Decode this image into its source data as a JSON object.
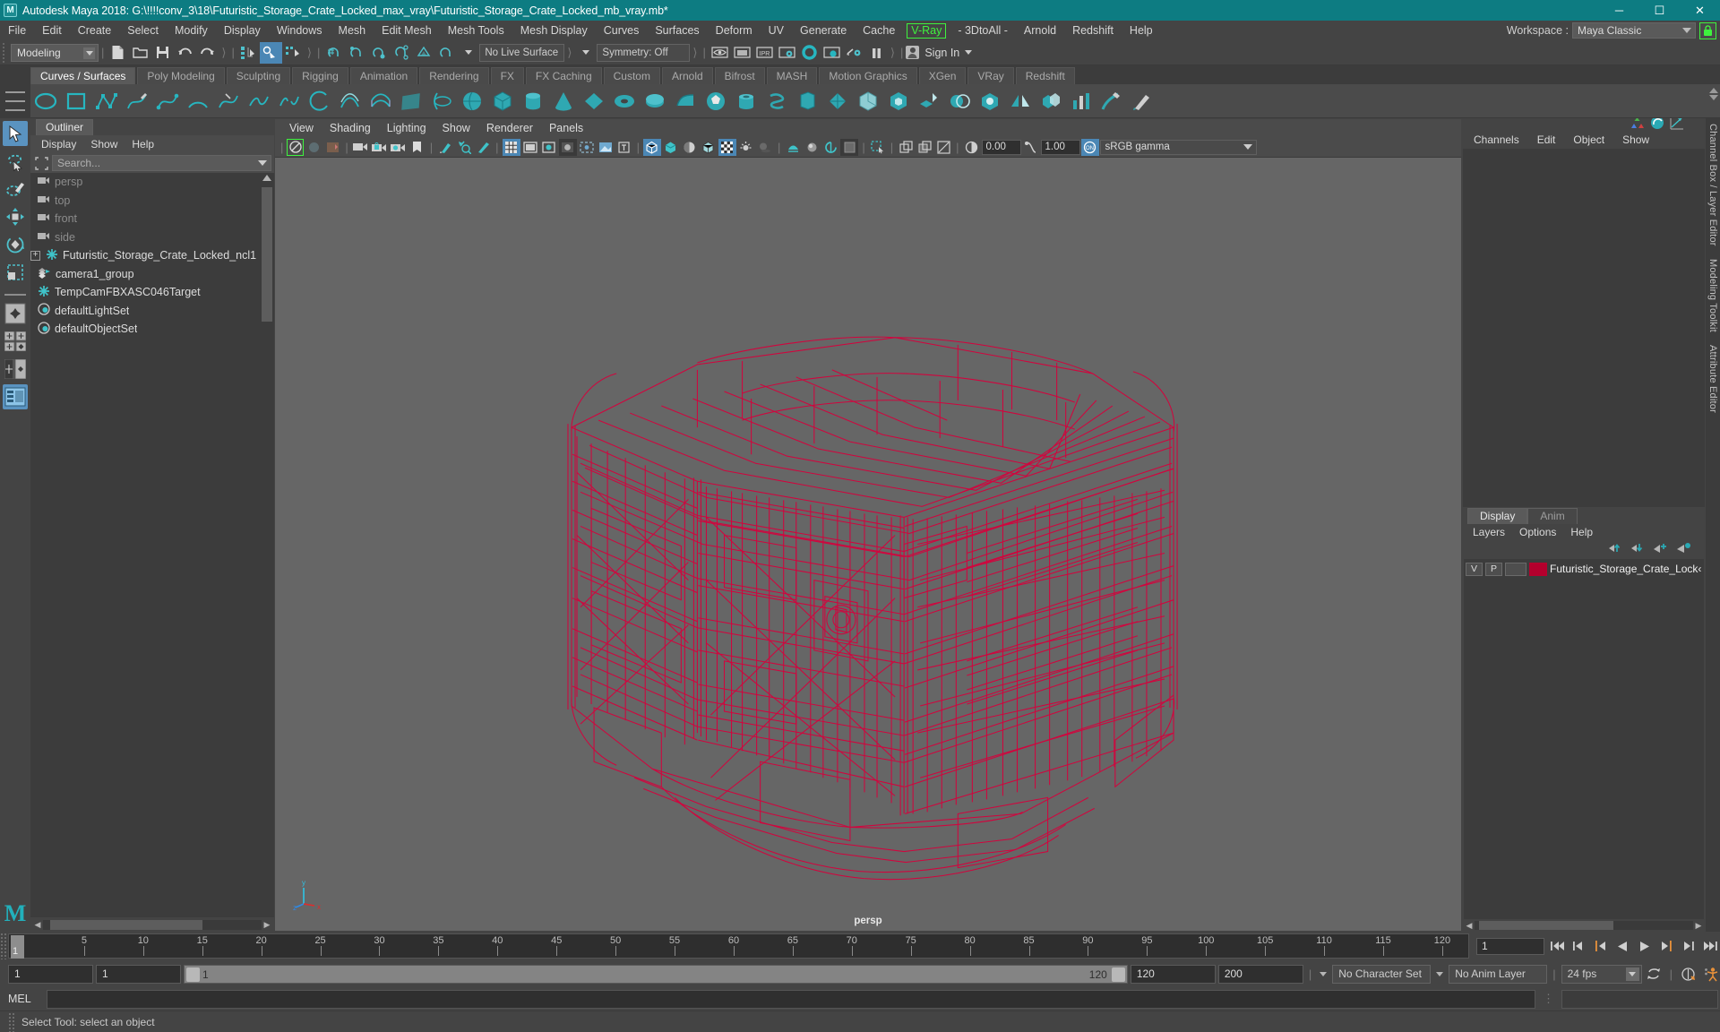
{
  "titlebar": {
    "app_title": "Autodesk Maya 2018: G:\\!!!!conv_3\\18\\Futuristic_Storage_Crate_Locked_max_vray\\Futuristic_Storage_Crate_Locked_mb_vray.mb*",
    "logo": "M",
    "minimize": "─",
    "maximize": "☐",
    "close": "✕"
  },
  "menubar": {
    "items": [
      "File",
      "Edit",
      "Create",
      "Select",
      "Modify",
      "Display",
      "Windows",
      "Mesh",
      "Edit Mesh",
      "Mesh Tools",
      "Mesh Display",
      "Curves",
      "Surfaces",
      "Deform",
      "UV",
      "Generate",
      "Cache"
    ],
    "vray": "V-Ray",
    "after_vray": [
      "- 3DtoAll -",
      "Arnold",
      "Redshift",
      "Help"
    ],
    "workspace_label": "Workspace :",
    "workspace_value": "Maya Classic",
    "lock_icon": "lock-icon"
  },
  "statusline": {
    "mode": "Modeling",
    "no_live_surface": "No Live Surface",
    "symmetry": "Symmetry: Off",
    "sign_in": "Sign In"
  },
  "shelf": {
    "tabs": [
      "Curves / Surfaces",
      "Poly Modeling",
      "Sculpting",
      "Rigging",
      "Animation",
      "Rendering",
      "FX",
      "FX Caching",
      "Custom",
      "Arnold",
      "Bifrost",
      "MASH",
      "Motion Graphics",
      "XGen",
      "VRay",
      "Redshift"
    ],
    "active_tab": "Curves / Surfaces"
  },
  "toolbox": {
    "items": [
      "select-tool",
      "lasso-select-tool",
      "paint-select-tool",
      "move-tool",
      "rotate-tool",
      "scale-tool",
      "last-tool",
      "snap-grid",
      "layout-four-view",
      "layout-two-pane",
      "layout-outliner"
    ]
  },
  "outliner": {
    "tab": "Outliner",
    "menus": [
      "Display",
      "Show",
      "Help"
    ],
    "search_placeholder": "Search...",
    "items": [
      {
        "label": "persp",
        "icon": "camera-icon",
        "dim": true,
        "expandable": false
      },
      {
        "label": "top",
        "icon": "camera-icon",
        "dim": true,
        "expandable": false
      },
      {
        "label": "front",
        "icon": "camera-icon",
        "dim": true,
        "expandable": false
      },
      {
        "label": "side",
        "icon": "camera-icon",
        "dim": true,
        "expandable": false
      },
      {
        "label": "Futuristic_Storage_Crate_Locked_ncl1",
        "icon": "transform-icon",
        "dim": false,
        "expandable": true
      },
      {
        "label": "camera1_group",
        "icon": "group-icon",
        "dim": false,
        "expandable": false
      },
      {
        "label": "TempCamFBXASC046Target",
        "icon": "transform-icon",
        "dim": false,
        "expandable": false
      },
      {
        "label": "defaultLightSet",
        "icon": "set-icon",
        "dim": false,
        "expandable": false
      },
      {
        "label": "defaultObjectSet",
        "icon": "set-icon",
        "dim": false,
        "expandable": false
      }
    ]
  },
  "viewport": {
    "menus": [
      "View",
      "Shading",
      "Lighting",
      "Show",
      "Renderer",
      "Panels"
    ],
    "exposure": "0.00",
    "gamma_value": "1.00",
    "color_space": "sRGB gamma",
    "camera_label": "persp",
    "background_color": "#666666",
    "wireframe_color": "#d6003c",
    "axis_labels": {
      "y": "y",
      "z": "z",
      "x": "x"
    }
  },
  "channelbox": {
    "menus": [
      "Channels",
      "Edit",
      "Object",
      "Show"
    ],
    "side_tabs": [
      "Channel Box / Layer Editor",
      "Modeling Toolkit",
      "Attribute Editor"
    ]
  },
  "layereditor": {
    "tabs": [
      "Display",
      "Anim"
    ],
    "active_tab": "Display",
    "menus": [
      "Layers",
      "Options",
      "Help"
    ],
    "layers": [
      {
        "visible": "V",
        "playback": "P",
        "color": "#b4002d",
        "name": "Futuristic_Storage_Crate_Lock‹"
      }
    ]
  },
  "timeslider": {
    "ticks": [
      5,
      10,
      15,
      20,
      25,
      30,
      35,
      40,
      45,
      50,
      55,
      60,
      65,
      70,
      75,
      80,
      85,
      90,
      95,
      100,
      105,
      110,
      115,
      120
    ],
    "current_frame": "1",
    "current_frame_field": "1",
    "max_tick": 120
  },
  "rangeslider": {
    "start_field": "1",
    "anim_start_field": "1",
    "range_start": "1",
    "range_end": "120",
    "anim_end_field": "120",
    "playback_end_field": "200",
    "character_set": "No Character Set",
    "anim_layer": "No Anim Layer",
    "fps": "24 fps"
  },
  "commandline": {
    "mel_label": "MEL",
    "mel_value": ""
  },
  "statusbar": {
    "message": "Select Tool: select an object"
  }
}
